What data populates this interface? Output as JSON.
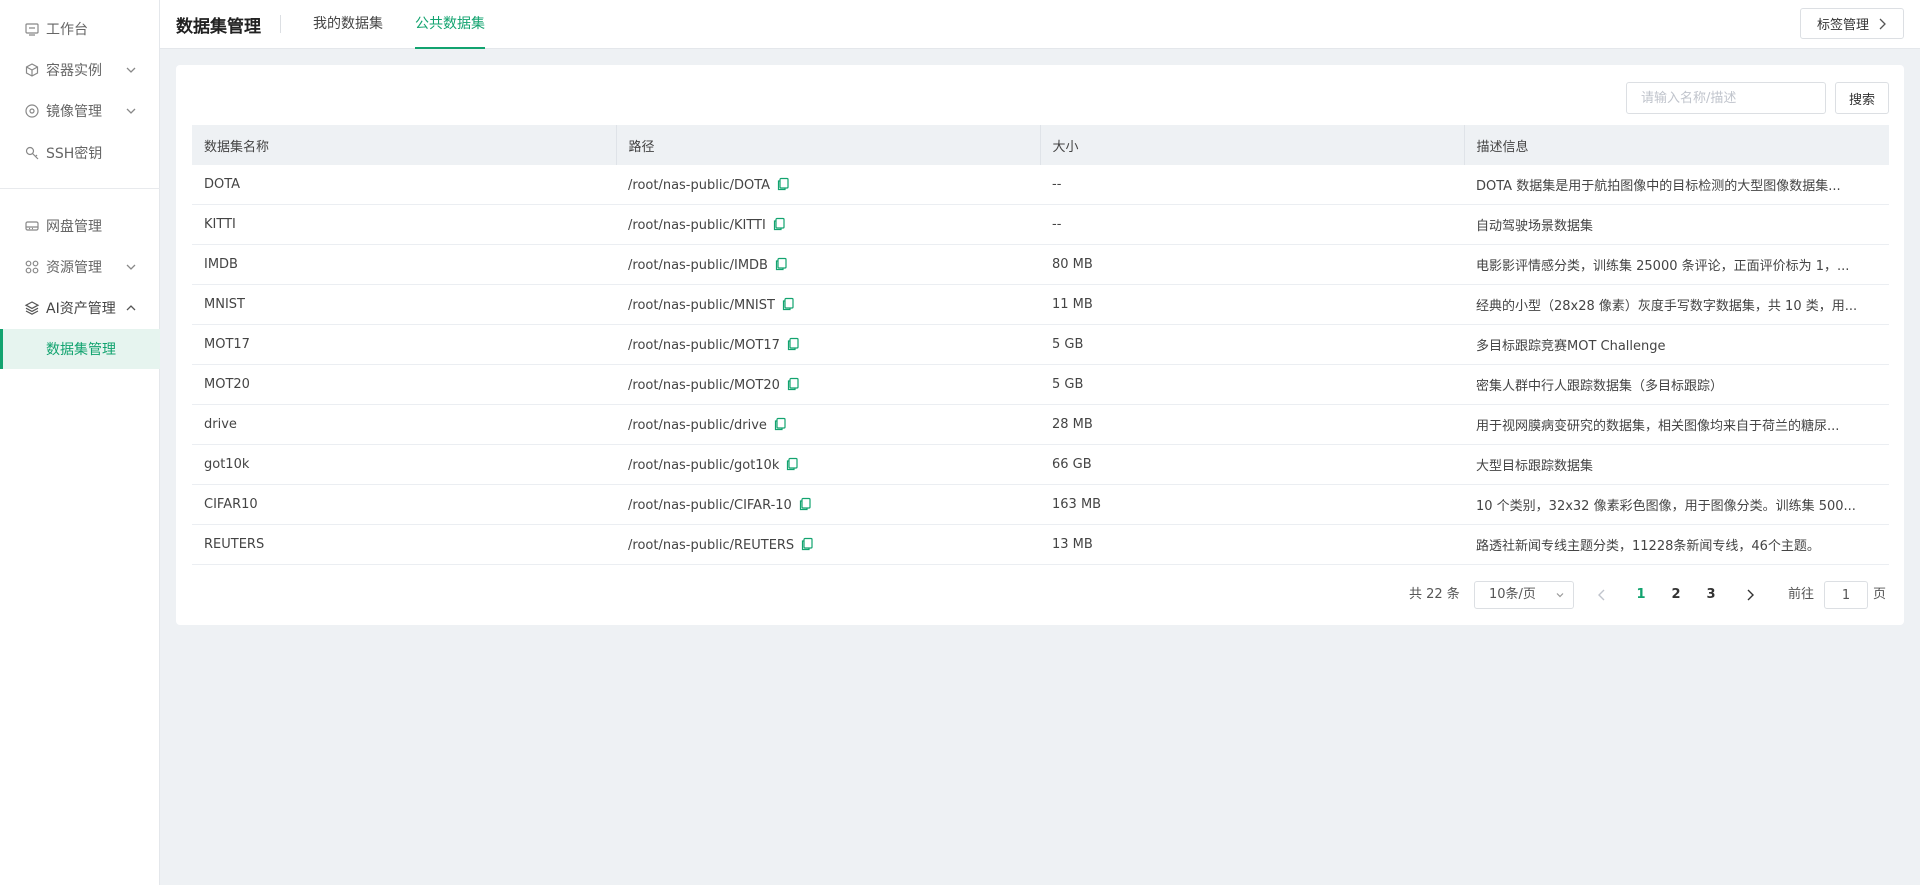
{
  "sidebar": {
    "items": [
      {
        "label": "工作台",
        "icon": "workbench-icon"
      },
      {
        "label": "容器实例",
        "icon": "cube-icon"
      },
      {
        "label": "镜像管理",
        "icon": "disc-icon"
      },
      {
        "label": "SSH密钥",
        "icon": "key-icon"
      },
      {
        "label": "网盘管理",
        "icon": "drive-icon"
      },
      {
        "label": "资源管理",
        "icon": "grid-icon"
      },
      {
        "label": "AI资产管理",
        "icon": "layers-icon"
      },
      {
        "label": "数据集管理"
      }
    ]
  },
  "header": {
    "title": "数据集管理",
    "tabs": [
      {
        "label": "我的数据集"
      },
      {
        "label": "公共数据集",
        "active": true
      }
    ],
    "tag_button": "标签管理"
  },
  "search": {
    "placeholder": "请输入名称/描述",
    "button": "搜索"
  },
  "table": {
    "columns": [
      "数据集名称",
      "路径",
      "大小",
      "描述信息"
    ],
    "rows": [
      {
        "name": "DOTA",
        "path": "/root/nas-public/DOTA",
        "size": "--",
        "desc": "DOTA 数据集是用于航拍图像中的目标检测的大型图像数据集..."
      },
      {
        "name": "KITTI",
        "path": "/root/nas-public/KITTI",
        "size": "--",
        "desc": "自动驾驶场景数据集"
      },
      {
        "name": "IMDB",
        "path": "/root/nas-public/IMDB",
        "size": "80 MB",
        "desc": "电影影评情感分类，训练集 25000 条评论，正面评价标为 1，..."
      },
      {
        "name": "MNIST",
        "path": "/root/nas-public/MNIST",
        "size": "11 MB",
        "desc": "经典的小型（28x28 像素）灰度手写数字数据集，共 10 类，用..."
      },
      {
        "name": "MOT17",
        "path": "/root/nas-public/MOT17",
        "size": "5 GB",
        "desc": "多目标跟踪竞赛MOT Challenge"
      },
      {
        "name": "MOT20",
        "path": "/root/nas-public/MOT20",
        "size": "5 GB",
        "desc": "密集人群中行人跟踪数据集（多目标跟踪）"
      },
      {
        "name": "drive",
        "path": "/root/nas-public/drive",
        "size": "28 MB",
        "desc": "用于视网膜病变研究的数据集，相关图像均来自于荷兰的糖尿..."
      },
      {
        "name": "got10k",
        "path": "/root/nas-public/got10k",
        "size": "66 GB",
        "desc": "大型目标跟踪数据集"
      },
      {
        "name": "CIFAR10",
        "path": "/root/nas-public/CIFAR-10",
        "size": "163 MB",
        "desc": "10 个类别，32x32 像素彩色图像，用于图像分类。训练集 500..."
      },
      {
        "name": "REUTERS",
        "path": "/root/nas-public/REUTERS",
        "size": "13 MB",
        "desc": "路透社新闻专线主题分类，11228条新闻专线，46个主题。"
      }
    ]
  },
  "pagination": {
    "total_text": "共 22 条",
    "page_size": "10条/页",
    "pages": [
      "1",
      "2",
      "3"
    ],
    "current": "1",
    "goto_prefix": "前往",
    "goto_value": "1",
    "goto_suffix": "页"
  },
  "colors": {
    "accent": "#12a36f",
    "background": "#eef1f4"
  }
}
